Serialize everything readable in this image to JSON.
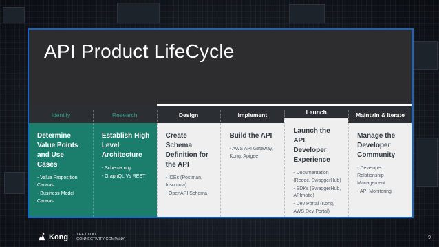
{
  "slide": {
    "title": "API Product LifeCycle",
    "page_number": "9"
  },
  "stages": [
    {
      "label": "Identify",
      "state": "done",
      "title": "Determine Value Points and Use Cases",
      "items": [
        "- Value Proposition Canvas",
        "- Business Model Canvas"
      ]
    },
    {
      "label": "Research",
      "state": "done",
      "title": "Establish High Level Architecture",
      "items": [
        "- Schema.org",
        "- GraphQL Vs REST"
      ]
    },
    {
      "label": "Design",
      "state": "active",
      "title": "Create Schema Definition for the API",
      "items": [
        "- IDEs (Postman, Insomnia)",
        "- OpenAPI Schema"
      ]
    },
    {
      "label": "Implement",
      "state": "active",
      "title": "Build the API",
      "items": [
        "- AWS API Gateway, Kong, Apigee"
      ]
    },
    {
      "label": "Launch",
      "state": "active",
      "title": "Launch the API, Developer Experience",
      "items": [
        "- Documentation (Redoc, SwaggerHub)",
        "- SDKs (SwaggerHub, APImatic)",
        "- Dev Portal (Kong, AWS Dev Portal)"
      ]
    },
    {
      "label": "Maintain & Iterate",
      "state": "active",
      "title": "Manage the Developer Community",
      "items": [
        "- Developer Relationship Management",
        "- API Monitoring"
      ]
    }
  ],
  "footer": {
    "brand": "Kong",
    "tagline_line1": "THE CLOUD",
    "tagline_line2": "CONNECTIVITY COMPANY",
    "logo_icon": "kong-gorilla-icon"
  },
  "colors": {
    "accent_border": "#1565c8",
    "done_stage": "#1b7e6d",
    "done_label": "#2e9a86",
    "active_body": "#efefef",
    "header_bg": "#2d2d30"
  }
}
